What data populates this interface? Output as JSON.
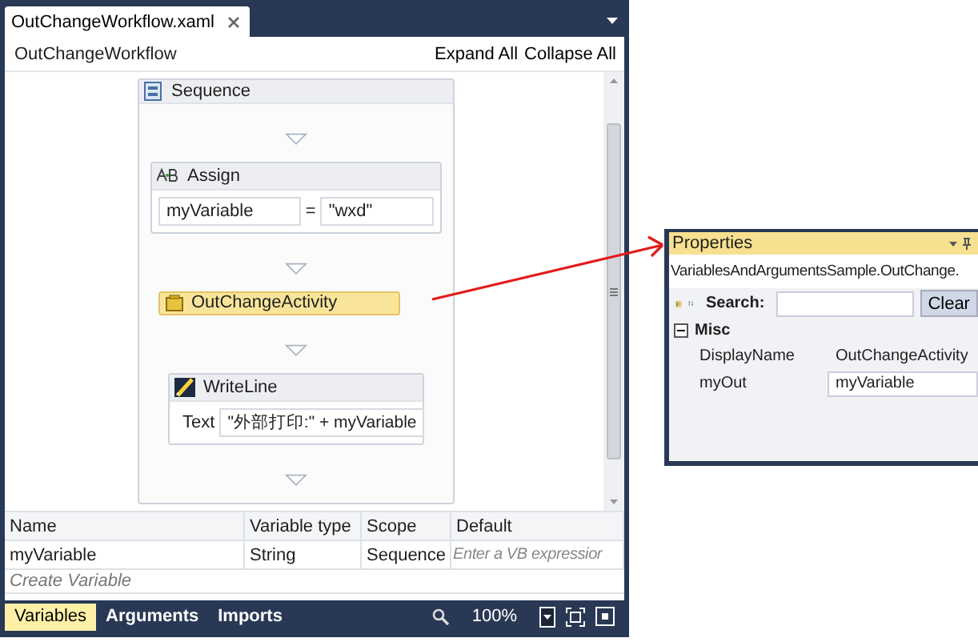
{
  "document_tab": {
    "label": "OutChangeWorkflow.xaml",
    "selected": true
  },
  "breadcrumb": "OutChangeWorkflow",
  "header_actions": [
    "Expand All",
    "Collapse All"
  ],
  "sequence": {
    "title": "Sequence",
    "activities": [
      {
        "kind": "assign",
        "title": "Assign",
        "to": "myVariable",
        "operator": "=",
        "value": "\"wxd\"",
        "selected": false
      },
      {
        "kind": "custom",
        "title": "OutChangeActivity",
        "selected": true
      },
      {
        "kind": "writeline",
        "title": "WriteLine",
        "field_label": "Text",
        "value": "\"外部打印:\" + myVariable",
        "selected": false
      }
    ]
  },
  "variables": {
    "columns": [
      "Name",
      "Variable type",
      "Scope",
      "Default"
    ],
    "rows": [
      {
        "cells": [
          "myVariable",
          "String",
          "Sequence"
        ],
        "default_placeholder": "Enter a VB expressior"
      }
    ],
    "create_label": "Create Variable"
  },
  "bottom_tabs": [
    {
      "label": "Variables",
      "selected": true
    },
    {
      "label": "Arguments",
      "selected": false
    },
    {
      "label": "Imports",
      "selected": false
    }
  ],
  "zoom": "100%",
  "properties": {
    "title": "Properties",
    "object": "VariablesAndArgumentsSample.OutChange.",
    "search_label": "Search:",
    "clear_button": "Clear",
    "category": {
      "label": "Misc",
      "expanded": true
    },
    "rows": [
      {
        "name": "DisplayName",
        "value": "OutChangeActivity",
        "kind": "text"
      },
      {
        "name": "myOut",
        "value": "myVariable",
        "kind": "field"
      }
    ]
  }
}
